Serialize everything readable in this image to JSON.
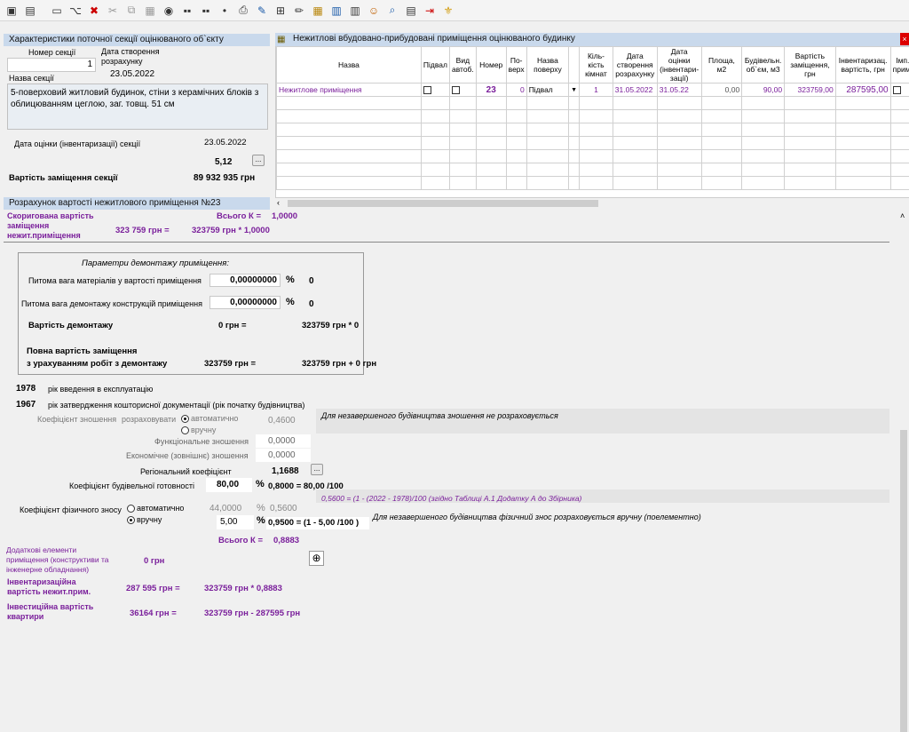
{
  "toolbar": {
    "icons": [
      "save-icon",
      "save-all-icon",
      "new-icon",
      "tree-icon",
      "delete-icon",
      "copy-icon",
      "paste-icon",
      "db-icon",
      "dots-icon",
      "dots2-icon",
      "dot-icon",
      "print-icon",
      "edit-doc-icon",
      "add-doc-icon",
      "pencil-icon",
      "table-icon",
      "chart-icon",
      "chart2-icon",
      "people-icon",
      "search-icon",
      "pdf-icon",
      "exit-icon",
      "emblem-icon"
    ]
  },
  "section": {
    "title": "Характеристики поточної секції оцінюваного об`єкту",
    "number_label": "Номер секції",
    "number_value": "1",
    "date_label": "Дата створення розрахунку",
    "date_value": "23.05.2022",
    "name_label": "Назва секції",
    "description": "5-поверховий житловий будинок, стіни з керамічних блоків з облицюванням цеглою, заг. товщ. 51 см",
    "eval_date_label": "Дата оцінки (інвентаризації) секції",
    "eval_date_value": "23.05.2022",
    "coef_value": "5,12",
    "replacement_label": "Вартість заміщення секції",
    "replacement_value": "89 932 935 грн"
  },
  "premises": {
    "title": "Нежитлові вбудовано-прибудовані приміщення оцінюваного будинку",
    "headers": [
      "Назва",
      "Підвал",
      "Вид автоб.",
      "Номер",
      "По-верх",
      "Назва поверху",
      "Кіль-кість кімнат",
      "Дата створення розрахунку",
      "Дата оцінки (інвентари-зації)",
      "Площа, м2",
      "Будівельн. об`єм, м3",
      "Вартість заміщення, грн",
      "Інвентаризац. вартість, грн",
      "Імп. прим."
    ],
    "row": {
      "name": "Нежитлове приміщення",
      "number": "23",
      "floor": "0",
      "floor_name": "Підвал",
      "rooms": "1",
      "date_created": "31.05.2022",
      "date_eval": "31.05.22",
      "area": "0,00",
      "volume": "90,00",
      "replacement": "323759,00",
      "inventory": "287595,00"
    }
  },
  "calc": {
    "title": "Розрахунок вартості нежитлового приміщення №23",
    "adjusted_label": "Скоригована вартість заміщення нежит.приміщення",
    "adjusted_value": "323 759 грн =",
    "adjusted_formula": "323759 грн * 1,0000",
    "total_k_label": "Всього К =",
    "total_k_value": "1,0000",
    "dismantle_title": "Параметри  демонтажу  приміщення:",
    "mat_label": "Питома вага матеріалів у вартості приміщення",
    "mat_value": "0,00000000",
    "mat_pct": "%",
    "mat_res": "0",
    "dem_label": "Питома вага демонтажу конструкцій приміщення",
    "dem_value": "0,00000000",
    "dem_pct": "%",
    "dem_res": "0",
    "dem_cost_label": "Вартість демонтажу",
    "dem_cost_value": "0 грн =",
    "dem_cost_formula": "323759 грн * 0",
    "full_label_1": "Повна вартість заміщення",
    "full_label_2": "з урахуванням робіт з демонтажу",
    "full_value": "323759 грн =",
    "full_formula": "323759 грн + 0 грн",
    "year_op": "1978",
    "year_op_label": "рік введення в експлуатацію",
    "year_doc": "1967",
    "year_doc_label": "рік затвердження кошторисної документації   (рік початку будівництва)",
    "wear_label": "Коефіцієнт зношення",
    "wear_calc": "розраховувати",
    "wear_auto": "автоматично",
    "wear_manual": "вручну",
    "wear_value": "0,4600",
    "wear_note": "Для незавершеного будівництва зношення не розраховується",
    "func_label": "Функціональне зношення",
    "func_value": "0,0000",
    "econ_label": "Економічне (зовнішнє) зношення",
    "econ_value": "0,0000",
    "reg_label": "Регіональний коефіцієнт",
    "reg_value": "1,1688",
    "ready_label": "Коефіцієнт будівельної готовності",
    "ready_value": "80,00",
    "ready_pct": "%",
    "ready_formula": "0,8000 = 80,00 /100",
    "phys_hint": "0,5600 = (1 - (2022 - 1978)/100 (згідно Таблиці А.1 Додатку А до Збірника)",
    "phys_label": "Коефіцієнт фізичного зносу",
    "phys_auto": "автоматично",
    "phys_auto_val": "44,0000",
    "phys_auto_pct": "%",
    "phys_auto_res": "0,5600",
    "phys_manual": "вручну",
    "phys_manual_val": "5,00",
    "phys_manual_pct": "%",
    "phys_formula": "0,9500 = (1 - 5,00 /100 )",
    "phys_note": "Для незавершеного будівництва фізичний знос розраховується вручну (поелементно)",
    "total_k2_label": "Всього К =",
    "total_k2_value": "0,8883",
    "extra_label": "Додаткові елементи приміщення (конструктиви та інженерне обладнання)",
    "extra_value": "0 грн",
    "inv_label": "Інвентаризаційна вартість нежит.прим.",
    "inv_value": "287 595 грн =",
    "inv_formula": "323759 грн * 0,8883",
    "invest_label": "Інвестиційна вартість квартири",
    "invest_value": "36164 грн =",
    "invest_formula": "323759 грн - 287595 грн"
  }
}
